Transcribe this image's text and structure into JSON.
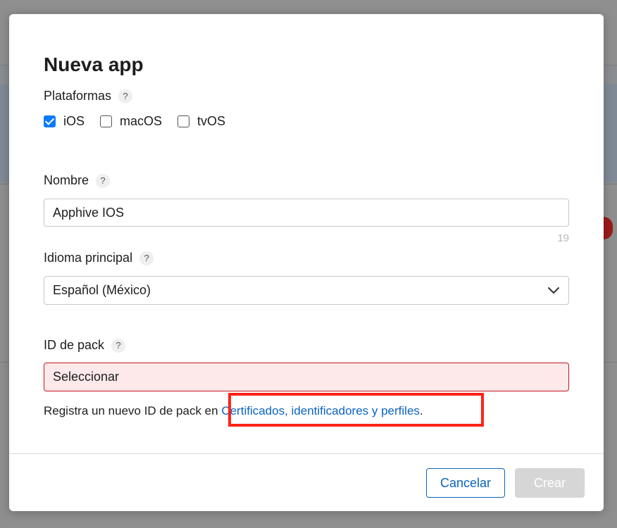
{
  "modal": {
    "title": "Nueva app"
  },
  "platforms": {
    "label": "Plataformas",
    "options": [
      {
        "label": "iOS",
        "checked": true
      },
      {
        "label": "macOS",
        "checked": false
      },
      {
        "label": "tvOS",
        "checked": false
      }
    ]
  },
  "name": {
    "label": "Nombre",
    "value": "Apphive IOS",
    "remaining_chars": "19"
  },
  "language": {
    "label": "Idioma principal",
    "selected": "Español (México)"
  },
  "bundle_id": {
    "label": "ID de pack",
    "selected": "Seleccionar",
    "register_prefix": "Registra un nuevo ID de pack en ",
    "register_link": "Certificados, identificadores y perfiles",
    "register_suffix": "."
  },
  "footer": {
    "cancel_label": "Cancelar",
    "create_label": "Crear"
  },
  "help_glyph": "?",
  "colors": {
    "accent": "#0a7aff",
    "link": "#0b64c0",
    "error_border": "#c2141f",
    "error_bg": "#fde9ea",
    "highlight": "#ff2317",
    "disabled_button": "#d6d6d6"
  }
}
